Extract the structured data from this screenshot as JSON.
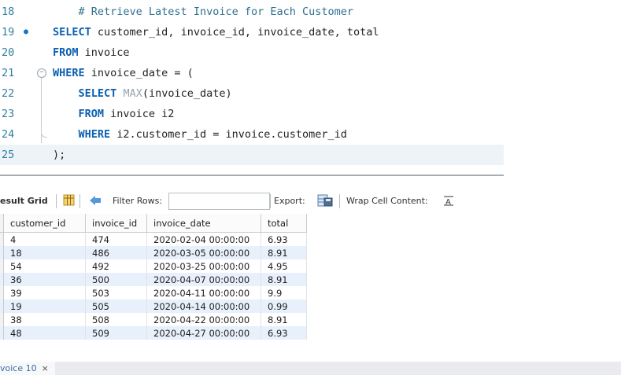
{
  "editor": {
    "lines": [
      {
        "num": "18",
        "parts": [
          {
            "t": "    "
          },
          {
            "t": "# Retrieve Latest Invoice for Each Customer",
            "c": "comment"
          }
        ]
      },
      {
        "num": "19",
        "marker": true,
        "parts": [
          {
            "t": "SELECT",
            "c": "kw"
          },
          {
            "t": " customer_id, invoice_id, invoice_date, total"
          }
        ]
      },
      {
        "num": "20",
        "parts": [
          {
            "t": "FROM",
            "c": "kw"
          },
          {
            "t": " invoice"
          }
        ]
      },
      {
        "num": "21",
        "fold": true,
        "parts": [
          {
            "t": "WHERE",
            "c": "kw"
          },
          {
            "t": " invoice_date = ("
          }
        ]
      },
      {
        "num": "22",
        "parts": [
          {
            "t": "    "
          },
          {
            "t": "SELECT",
            "c": "kw"
          },
          {
            "t": " "
          },
          {
            "t": "MAX",
            "c": "fn"
          },
          {
            "t": "(invoice_date)"
          }
        ]
      },
      {
        "num": "23",
        "parts": [
          {
            "t": "    "
          },
          {
            "t": "FROM",
            "c": "kw"
          },
          {
            "t": " invoice i2"
          }
        ]
      },
      {
        "num": "24",
        "parts": [
          {
            "t": "    "
          },
          {
            "t": "WHERE",
            "c": "kw"
          },
          {
            "t": " i2.customer_id = invoice.customer_id"
          }
        ]
      },
      {
        "num": "25",
        "current": true,
        "parts": [
          {
            "t": ");"
          }
        ]
      }
    ]
  },
  "toolbar": {
    "result_grid_label": "esult Grid",
    "filter_rows_label": "Filter Rows:",
    "filter_value": "",
    "export_label": "Export:",
    "wrap_label": "Wrap Cell Content:"
  },
  "grid": {
    "columns": [
      "customer_id",
      "invoice_id",
      "invoice_date",
      "total"
    ],
    "rows": [
      [
        "4",
        "474",
        "2020-02-04 00:00:00",
        "6.93"
      ],
      [
        "18",
        "486",
        "2020-03-05 00:00:00",
        "8.91"
      ],
      [
        "54",
        "492",
        "2020-03-25 00:00:00",
        "4.95"
      ],
      [
        "36",
        "500",
        "2020-04-07 00:00:00",
        "8.91"
      ],
      [
        "39",
        "503",
        "2020-04-11 00:00:00",
        "9.9"
      ],
      [
        "19",
        "505",
        "2020-04-14 00:00:00",
        "0.99"
      ],
      [
        "38",
        "508",
        "2020-04-22 00:00:00",
        "8.91"
      ],
      [
        "48",
        "509",
        "2020-04-27 00:00:00",
        "6.93"
      ]
    ]
  },
  "tabs": [
    {
      "label": "voice 10",
      "close": "×"
    }
  ],
  "icons": {
    "grid": "grid-icon",
    "refresh": "refresh-icon",
    "export": "export-icon",
    "wrap": "wrap-text-icon",
    "close": "close-icon"
  },
  "colors": {
    "keyword": "#0b5fb0",
    "line_number": "#2f7f9f",
    "alt_row": "#e8f0fb"
  }
}
